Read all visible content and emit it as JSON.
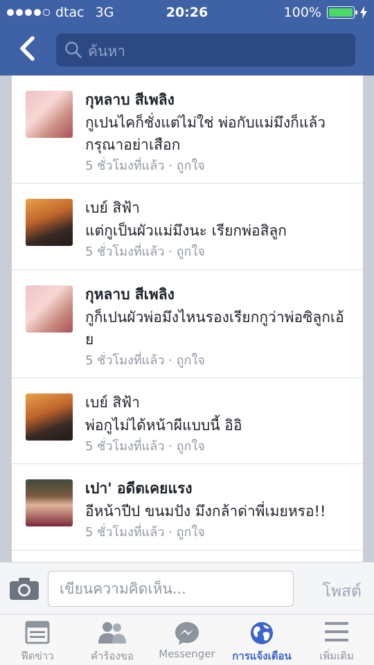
{
  "status_bar": {
    "carrier": "dtac",
    "network": "3G",
    "time": "20:26",
    "battery": "100%",
    "signal_bars": 4,
    "battery_level": 1.0
  },
  "nav": {
    "back_icon": "chevron-left-icon",
    "search_placeholder": "ค้นหา"
  },
  "comments": [
    {
      "name": "กุหลาบ สีเพลิง",
      "bold": true,
      "avatar": "a1",
      "message": "กูเปนไคก็ชั่งแต่ไม่ใช่ พ่อกับแม่มึงก็แล้วกรุณาอย่าเสือก",
      "time": "5 ชั่วโมงที่แล้ว",
      "like": "ถูกใจ"
    },
    {
      "name": "เบย์ สิฟ้า",
      "bold": false,
      "avatar": "a2",
      "message": "แต่กูเป็นผัวแม่มึงนะ เรียกพ่อสิลูก",
      "time": "5 ชั่วโมงที่แล้ว",
      "like": "ถูกใจ"
    },
    {
      "name": "กุหลาบ สีเพลิง",
      "bold": true,
      "avatar": "a1",
      "message": "กูก็เปนผัวพ่อมึงไหนรองเรียกกูว่าพ่อซิลูกเอ้ย",
      "time": "5 ชั่วโมงที่แล้ว",
      "like": "ถูกใจ"
    },
    {
      "name": "เบย์ สิฟ้า",
      "bold": false,
      "avatar": "a2",
      "message": "พ่อกูไม่ได้หน้าผีแบบนี้ อิอิ",
      "time": "5 ชั่วโมงที่แล้ว",
      "like": "ถูกใจ"
    },
    {
      "name": "เปา' อดีตเคยแรง",
      "bold": true,
      "avatar": "a3",
      "message": "อีหน้าปีป ขนมปัง มึงกล้าด่าพี่เมยหรอ!!",
      "time": "5 ชั่วโมงที่แล้ว",
      "like": "ถูกใจ"
    }
  ],
  "meta_separator": "·",
  "compose": {
    "placeholder": "เขียนความคิดเห็น...",
    "post_label": "โพสต์",
    "camera_icon": "camera-icon"
  },
  "tabs": [
    {
      "label": "ฟีดข่าว",
      "icon": "news-feed-icon",
      "active": false
    },
    {
      "label": "คำร้องขอ",
      "icon": "friend-requests-icon",
      "active": false
    },
    {
      "label": "Messenger",
      "icon": "messenger-icon",
      "active": false
    },
    {
      "label": "การแจ้งเตือน",
      "icon": "globe-icon",
      "active": true
    },
    {
      "label": "เพิ่มเติม",
      "icon": "menu-icon",
      "active": false
    }
  ],
  "colors": {
    "header": "#3f62a6",
    "active_tab": "#3b64cc",
    "muted": "#9197a3"
  }
}
